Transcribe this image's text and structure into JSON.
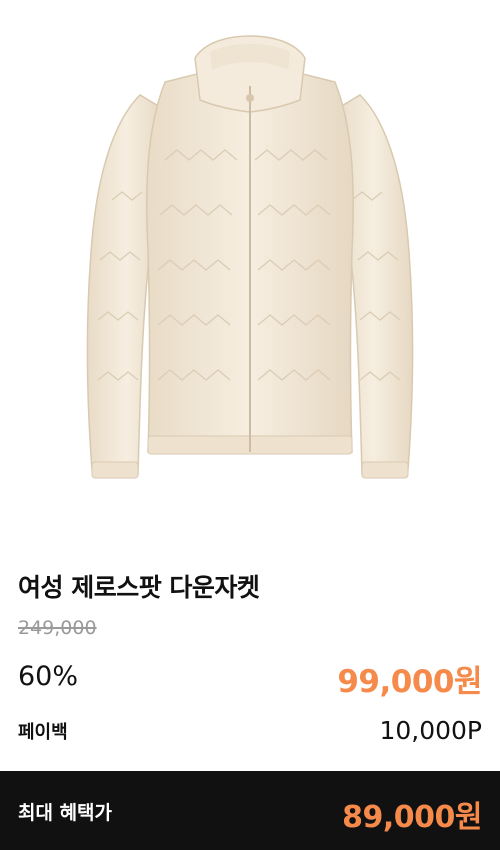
{
  "product": {
    "name": "여성 제로스팟 다운자켓",
    "original_price": "249,000",
    "discount_rate": "60%",
    "sale_price": "99,000원",
    "point_label": "페이백",
    "point_value": "10,000P"
  },
  "benefit": {
    "label": "최대 혜택가",
    "price": "89,000원"
  },
  "colors": {
    "accent": "#f58a4b",
    "bar_background": "#111111",
    "jacket": "#f3e9da"
  }
}
